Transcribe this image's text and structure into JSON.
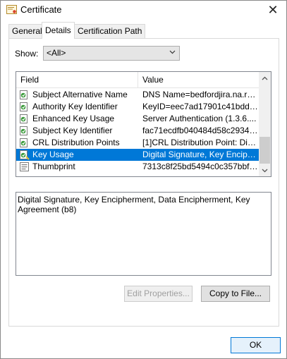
{
  "window": {
    "title": "Certificate",
    "close_glyph": "✕"
  },
  "tabs": [
    {
      "label": "General"
    },
    {
      "label": "Details",
      "active": true
    },
    {
      "label": "Certification Path"
    }
  ],
  "show": {
    "label": "Show:",
    "selected": "<All>"
  },
  "grid": {
    "headers": {
      "field": "Field",
      "value": "Value"
    },
    "rows": [
      {
        "field": "Subject Alternative Name",
        "value": "DNS Name=bedfordjira.na.rsa...",
        "icon": "cert-extension-icon"
      },
      {
        "field": "Authority Key Identifier",
        "value": "KeyID=eec7ad17901c41bdd7...",
        "icon": "cert-extension-icon"
      },
      {
        "field": "Enhanced Key Usage",
        "value": "Server Authentication (1.3.6....",
        "icon": "cert-extension-icon"
      },
      {
        "field": "Subject Key Identifier",
        "value": "fac71ecdfb040484d58c29340...",
        "icon": "cert-extension-icon"
      },
      {
        "field": "CRL Distribution Points",
        "value": "[1]CRL Distribution Point: Distr...",
        "icon": "cert-extension-icon"
      },
      {
        "field": "Key Usage",
        "value": "Digital Signature, Key Encipher...",
        "icon": "critical-extension-icon",
        "selected": true
      },
      {
        "field": "Thumbprint",
        "value": "7313c8f25bd5494c0c357bbf3...",
        "icon": "property-icon"
      }
    ]
  },
  "detail": {
    "text": "Digital Signature, Key Encipherment, Data Encipherment, Key Agreement (b8)"
  },
  "buttons": {
    "edit_properties": "Edit Properties...",
    "copy_to_file": "Copy to File...",
    "ok": "OK"
  },
  "colors": {
    "selection": "#0078d7",
    "window_bg": "#ffffff",
    "button_bg": "#e1e1e1"
  }
}
